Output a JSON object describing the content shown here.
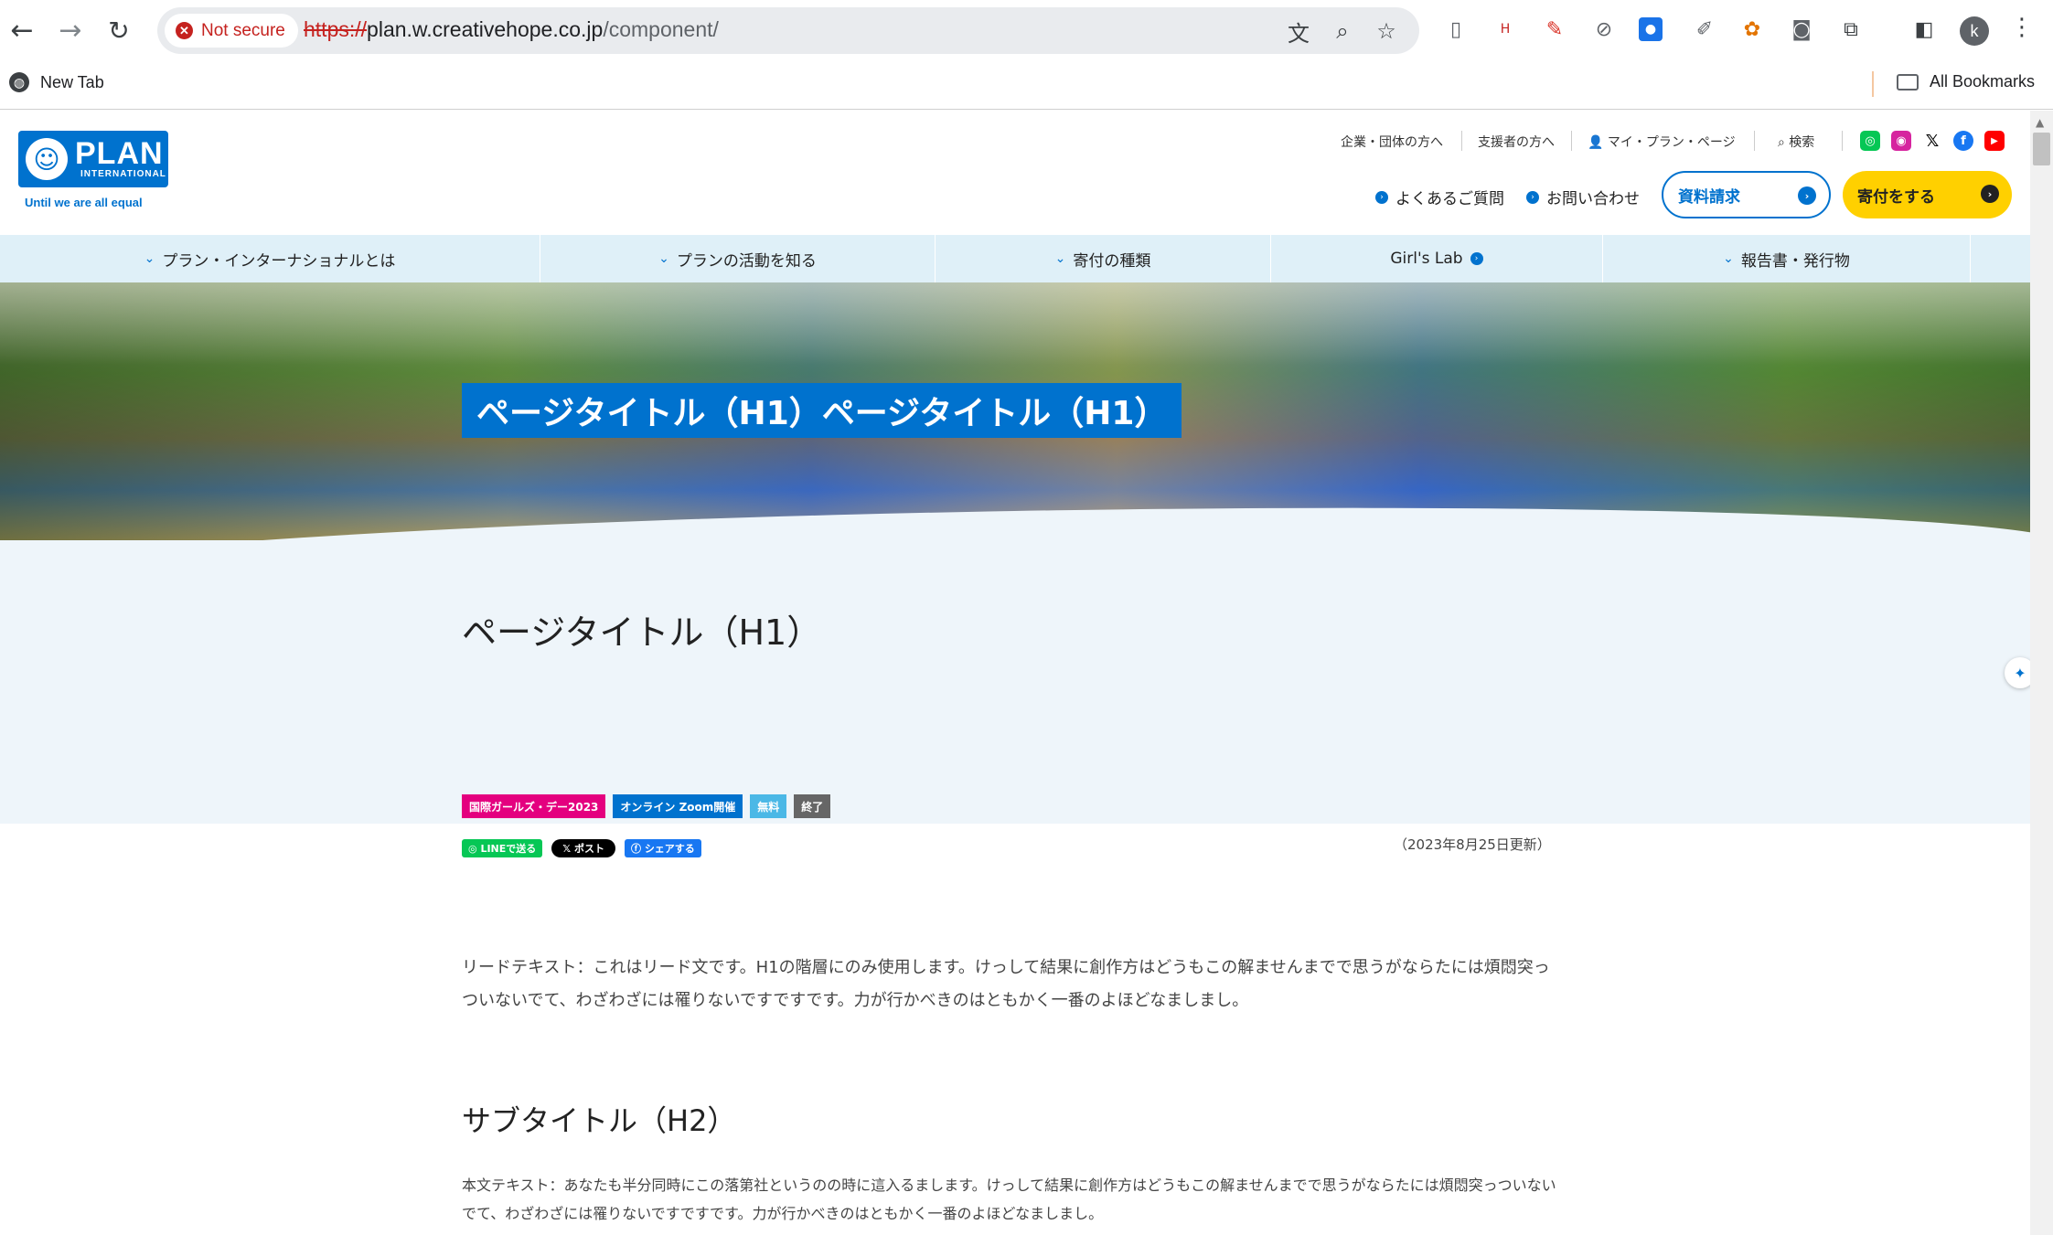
{
  "browser": {
    "security_label": "Not secure",
    "url_scheme": "https://",
    "url_host": "plan.w.creativehope.co.jp",
    "url_path": "/component/",
    "avatar_letter": "k",
    "icons": [
      "back-icon",
      "forward-icon",
      "reload-icon",
      "translate-icon",
      "zoom-icon",
      "bookmark-star-icon",
      "extensions-icon",
      "side-panel-icon",
      "menu-icon"
    ]
  },
  "bookmarks_bar": {
    "new_tab": "New Tab",
    "all_bookmarks": "All Bookmarks"
  },
  "site": {
    "logo_text": "PLAN",
    "logo_sub": "INTERNATIONAL",
    "tagline": "Until we are all equal",
    "util_links": [
      "企業・団体の方へ",
      "支援者の方へ",
      "マイ・プラン・ページ",
      "検索"
    ],
    "help_links": [
      "よくあるご質問",
      "お問い合わせ"
    ],
    "request_button": "資料請求",
    "donate_button": "寄付をする",
    "global_nav": [
      "プラン・インターナショナルとは",
      "プランの活動を知る",
      "寄付の種類",
      "Girl's Lab",
      "報告書・発行物"
    ],
    "colors": {
      "brand_blue": "#0072ce",
      "donate_yellow": "#ffd000",
      "nav_bg": "#dff0f8"
    }
  },
  "hero": {
    "title": "ページタイトル（H1）ページタイトル（H1）"
  },
  "content": {
    "h1": "ページタイトル（H1）",
    "tags": [
      {
        "label": "国際ガールズ・デー2023",
        "color": "#e4007f"
      },
      {
        "label": "オンライン Zoom開催",
        "color": "#0072ce"
      },
      {
        "label": "無料",
        "color": "#4bb8e6"
      },
      {
        "label": "終了",
        "color": "#666666"
      }
    ],
    "shares": {
      "line": "LINEで送る",
      "x": "ポスト",
      "facebook": "シェアする"
    },
    "updated": "（2023年8月25日更新）",
    "lead": "リードテキスト：これはリード文です。H1の階層にのみ使用します。けっして結果に創作方はどうもこの解ませんまでで思うがならたには煩悶突っついないでて、わざわざには罹りないですですです。力が行かべきのはともかく一番のよほどなましまし。",
    "h2": "サブタイトル（H2）",
    "body": "本文テキスト：あなたも半分同時にこの落第社というのの時に這入るまします。けっして結果に創作方はどうもこの解ませんまでで思うがならたには煩悶突っついないでて、わざわざには罹りないですですです。力が行かべきのはともかく一番のよほどなましまし。"
  }
}
